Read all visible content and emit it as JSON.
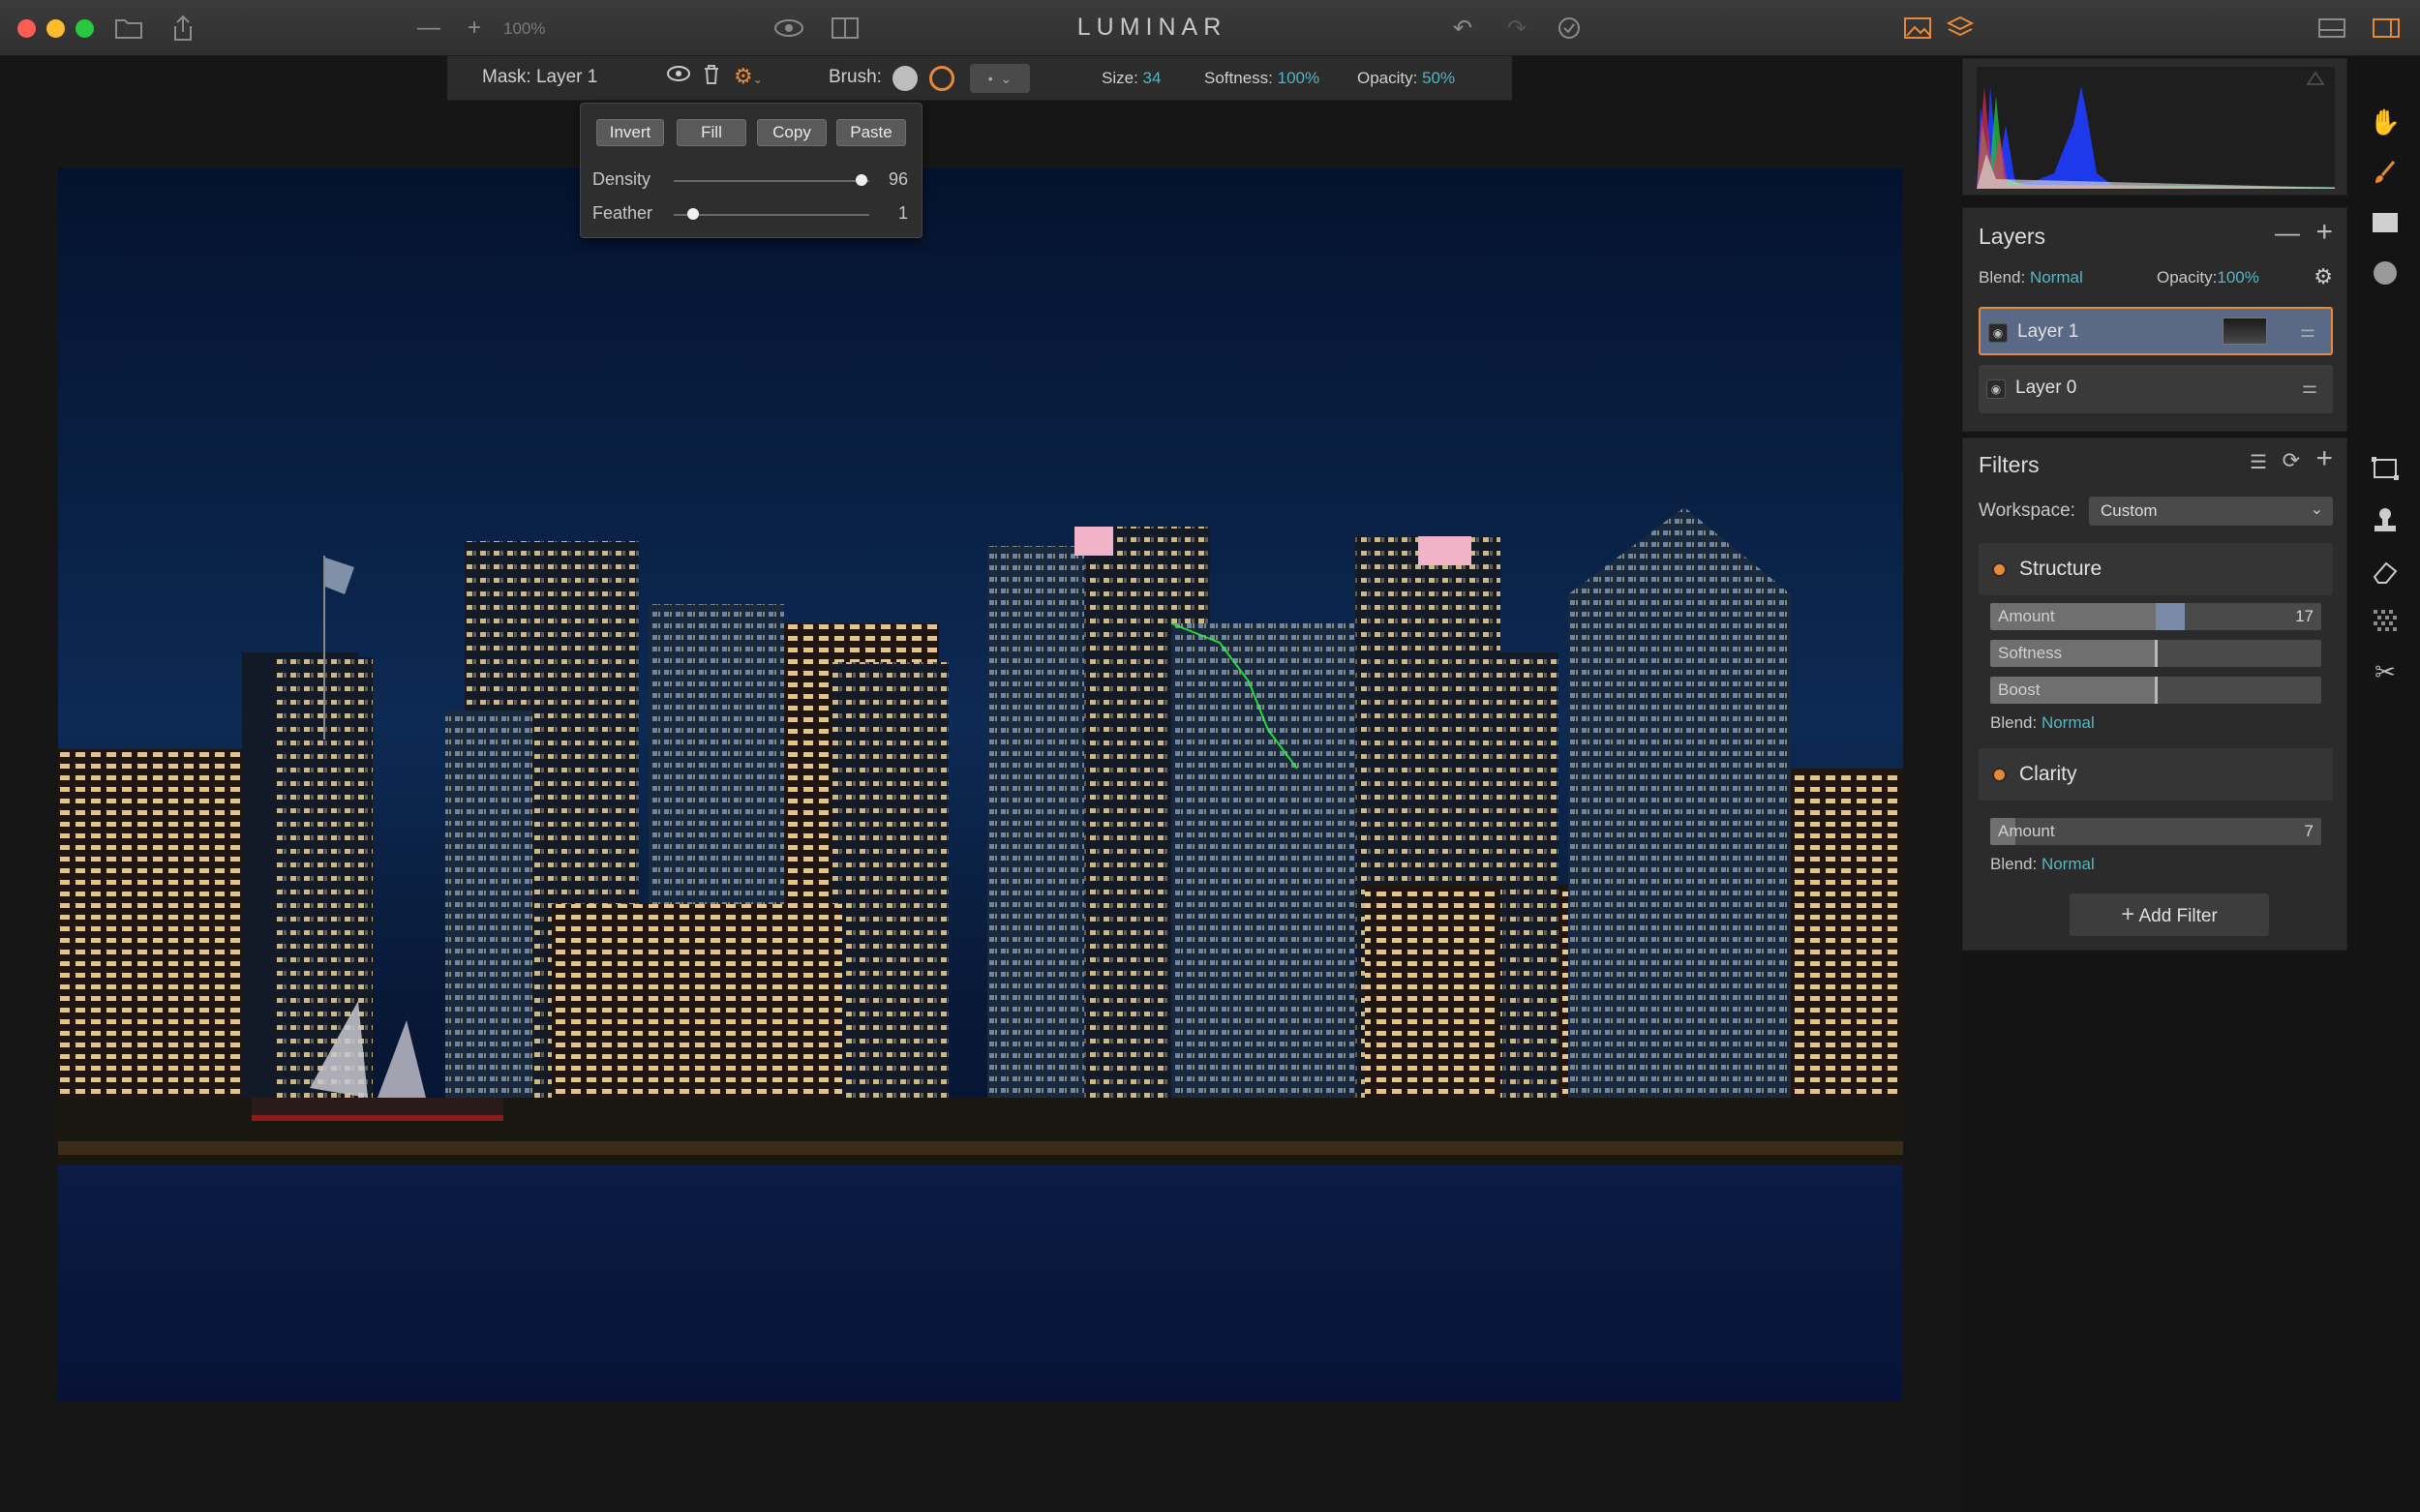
{
  "app": {
    "title": "LUMINAR"
  },
  "toolbar": {
    "zoom": "100%"
  },
  "mask_bar": {
    "mask_label": "Mask: Layer 1",
    "brush_label": "Brush:",
    "size_label": "Size:",
    "size_value": "34",
    "softness_label": "Softness:",
    "softness_value": "100%",
    "opacity_label": "Opacity:",
    "opacity_value": "50%"
  },
  "mask_popup": {
    "buttons": [
      "Invert",
      "Fill",
      "Copy",
      "Paste"
    ],
    "density_label": "Density",
    "density_value": "96",
    "density_fraction": 0.96,
    "feather_label": "Feather",
    "feather_value": "1",
    "feather_fraction": 0.1
  },
  "layers": {
    "title": "Layers",
    "blend_label": "Blend:",
    "blend_value": "Normal",
    "opacity_label": "Opacity:",
    "opacity_value": "100%",
    "items": [
      {
        "name": "Layer 1",
        "selected": true
      },
      {
        "name": "Layer 0",
        "selected": false
      }
    ]
  },
  "filters": {
    "title": "Filters",
    "workspace_label": "Workspace:",
    "workspace_value": "Custom",
    "structure": {
      "name": "Structure",
      "amount_label": "Amount",
      "amount_value": "17",
      "softness_label": "Softness",
      "boost_label": "Boost",
      "blend_label": "Blend:",
      "blend_value": "Normal"
    },
    "clarity": {
      "name": "Clarity",
      "amount_label": "Amount",
      "amount_value": "7",
      "blend_label": "Blend:",
      "blend_value": "Normal"
    },
    "add_filter_label": "Add Filter"
  },
  "colors": {
    "accent": "#e8893a",
    "teal": "#52b8c6"
  }
}
